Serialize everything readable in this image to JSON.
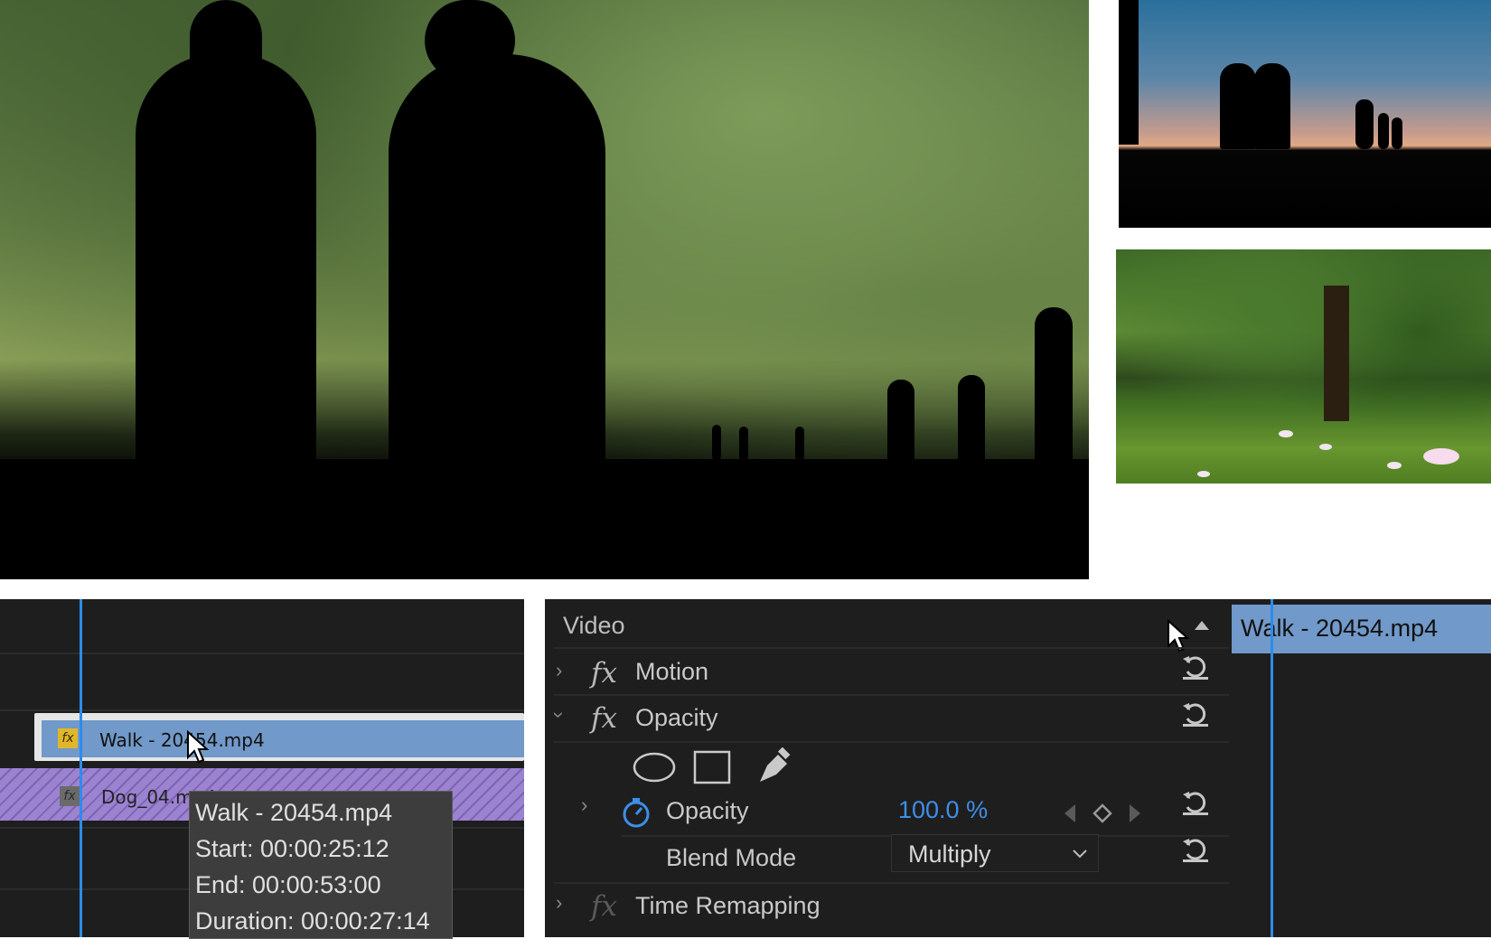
{
  "timeline": {
    "clip_walk_label": "Walk - 20454.mp4",
    "clip_dog_label": "Dog_04.mp4",
    "fx_badge": "fx"
  },
  "tooltip": {
    "title": "Walk - 20454.mp4",
    "start": "Start: 00:00:25:12",
    "end": "End: 00:00:53:00",
    "duration": "Duration: 00:00:27:14"
  },
  "effects": {
    "section_title": "Video",
    "fx_symbol": "fx",
    "motion_label": "Motion",
    "opacity_label": "Opacity",
    "opacity_prop_label": "Opacity",
    "opacity_value": "100.0 %",
    "blend_mode_label": "Blend Mode",
    "blend_mode_value": "Multiply",
    "time_remapping_label": "Time Remapping"
  },
  "mini_timeline": {
    "clip_label": "Walk - 20454.mp4"
  },
  "colors": {
    "accent_blue": "#2d8ceb",
    "clip_blue": "#7199c9",
    "clip_purple": "#9b83d0",
    "value_blue": "#3d8fe8"
  }
}
